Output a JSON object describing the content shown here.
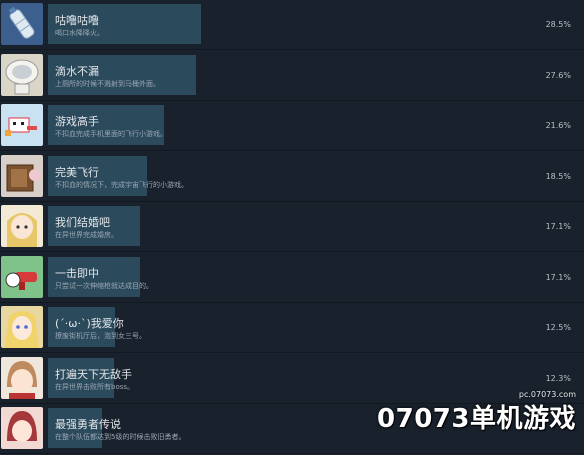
{
  "achievements": [
    {
      "title": "咕噜咕噜",
      "desc": "喝口水降降火。",
      "pct": "28.5%",
      "progress": 28.5,
      "icon": "water-bottle-icon",
      "icon_bg": "#3d5f8d"
    },
    {
      "title": "滴水不漏",
      "desc": "上厕所的时候不溅射到马桶外面。",
      "pct": "27.6%",
      "progress": 27.6,
      "icon": "toilet-icon",
      "icon_bg": "#d9d5c7"
    },
    {
      "title": "游戏高手",
      "desc": "不扣血完成手机里面的飞行小游戏。",
      "pct": "21.6%",
      "progress": 21.6,
      "icon": "pixel-character-icon",
      "icon_bg": "#c9e2f1"
    },
    {
      "title": "完美飞行",
      "desc": "不扣血的情况下，完成宇宙飞行的小游戏。",
      "pct": "18.5%",
      "progress": 18.5,
      "icon": "box-character-icon",
      "icon_bg": "#d8d0c8"
    },
    {
      "title": "我们结婚吧",
      "desc": "在异世界完成婚房。",
      "pct": "17.1%",
      "progress": 17.1,
      "icon": "blonde-girl-icon",
      "icon_bg": "#f3ead6"
    },
    {
      "title": "一击即中",
      "desc": "只尝试一次伸缩枪就达成目的。",
      "pct": "17.1%",
      "progress": 17.1,
      "icon": "glove-gun-icon",
      "icon_bg": "#7fc38b"
    },
    {
      "title": "(´·ω·`)我爱你",
      "desc": "撩废街机厅后，泡到女三号。",
      "pct": "12.5%",
      "progress": 12.5,
      "icon": "blonde-woman-icon",
      "icon_bg": "#e9d7a2"
    },
    {
      "title": "打遍天下无敌手",
      "desc": "在异世界击败所有boss。",
      "pct": "12.3%",
      "progress": 12.3,
      "icon": "brown-hair-boy-icon",
      "icon_bg": "#c08a5f"
    },
    {
      "title": "最强勇者传说",
      "desc": "在整个队伍都达到5级的时候击败旧勇者。",
      "pct": "",
      "progress": 10.0,
      "icon": "red-hair-hero-icon",
      "icon_bg": "#a4383a"
    }
  ],
  "watermark": {
    "url": "pc.07073.com",
    "logo": "07073单机游戏"
  }
}
